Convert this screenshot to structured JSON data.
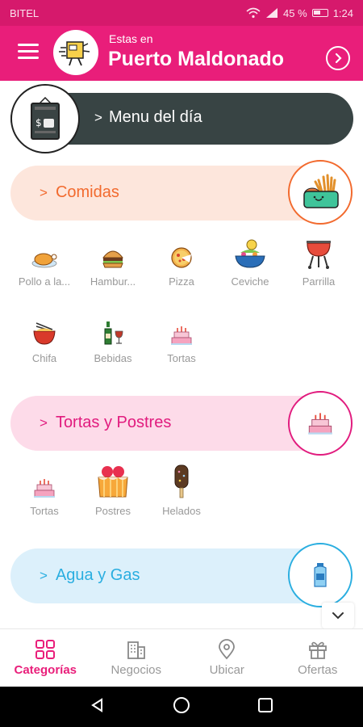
{
  "status_bar": {
    "carrier": "BITEL",
    "battery": "45 %",
    "time": "1:24"
  },
  "header": {
    "location_label": "Estas en",
    "city": "Puerto Maldonado"
  },
  "menu_dia": {
    "label": "Menu del día"
  },
  "categories": [
    {
      "label": "Comidas",
      "color": "#f26a2e",
      "bg": "#fde6dc",
      "items": [
        {
          "label": "Pollo a la...",
          "icon": "roast-chicken-icon"
        },
        {
          "label": "Hambur...",
          "icon": "burger-icon"
        },
        {
          "label": "Pizza",
          "icon": "pizza-icon"
        },
        {
          "label": "Ceviche",
          "icon": "ceviche-icon"
        },
        {
          "label": "Parrilla",
          "icon": "grill-icon"
        },
        {
          "label": "Chifa",
          "icon": "noodles-icon"
        },
        {
          "label": "Bebidas",
          "icon": "drinks-icon"
        },
        {
          "label": "Tortas",
          "icon": "cake-icon"
        }
      ]
    },
    {
      "label": "Tortas y Postres",
      "color": "#e11b7e",
      "bg": "#fddbe9",
      "items": [
        {
          "label": "Tortas",
          "icon": "cake-icon"
        },
        {
          "label": "Postres",
          "icon": "dessert-icon"
        },
        {
          "label": "Helados",
          "icon": "ice-cream-icon"
        }
      ]
    },
    {
      "label": "Agua y Gas",
      "color": "#2aaee0",
      "bg": "#dcf0fb",
      "items": []
    }
  ],
  "bottom_nav": [
    {
      "label": "Categorías",
      "icon": "grid-icon",
      "active": true
    },
    {
      "label": "Negocios",
      "icon": "buildings-icon",
      "active": false
    },
    {
      "label": "Ubicar",
      "icon": "location-pin-icon",
      "active": false
    },
    {
      "label": "Ofertas",
      "icon": "gift-icon",
      "active": false
    }
  ],
  "colors": {
    "primary": "#e91e7a",
    "status_bar": "#d6196c",
    "menu_dia_bg": "#384444"
  }
}
